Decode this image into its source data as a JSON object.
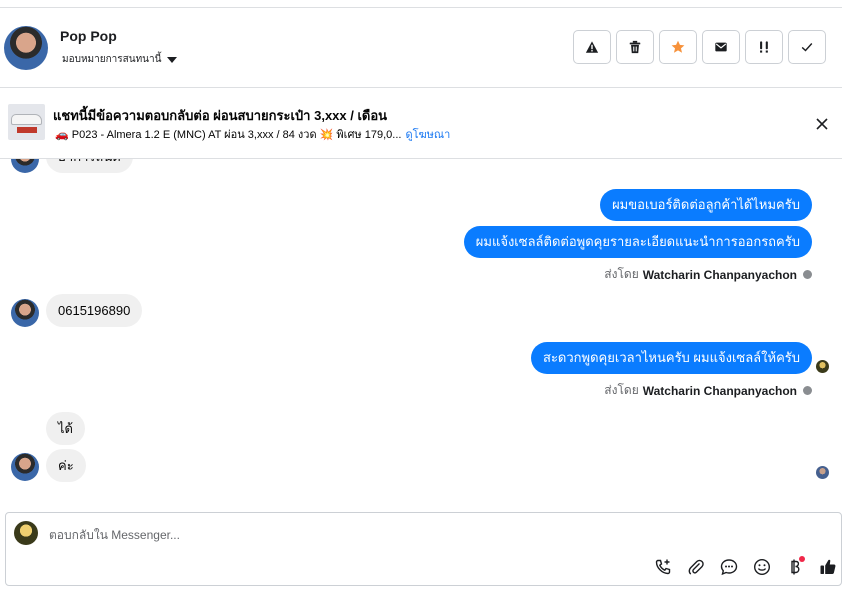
{
  "contact": {
    "name": "Pop Pop",
    "assign_label": "มอบหมายการสนทนานี้"
  },
  "header_actions": [
    {
      "name": "report-spam-icon"
    },
    {
      "name": "trash-icon"
    },
    {
      "name": "star-icon"
    },
    {
      "name": "mark-unread-icon"
    },
    {
      "name": "follow-up-icon"
    },
    {
      "name": "done-check-icon"
    }
  ],
  "ad": {
    "title": "แชทนี้มีข้อความตอบกลับต่อ ผ่อนสบายกระเป๋า 3,xxx / เดือน",
    "subtitle": "🚗 P023 - Almera 1.2 E (MNC) AT ผ่อน 3,xxx / 84 งวด 💥 พิเศษ 179,0...",
    "link": "ดูโฆษณา"
  },
  "messages": {
    "m0": "ฮาการลนด",
    "m1": "ผมขอเบอร์ติดต่อลูกค้าได้ไหมครับ",
    "m2": "ผมแจ้งเซลล์ติดต่อพูดคุยรายละเอียดแนะนำการออกรถครับ",
    "sent_prefix_1": "ส่งโดย",
    "sent_name_1": "Watcharin Chanpanyachon",
    "m3": "0615196890",
    "m4": "สะดวกพูดคุยเวลาไหนครับ ผมแจ้งเซลล์ให้ครับ",
    "sent_prefix_2": "ส่งโดย",
    "sent_name_2": "Watcharin Chanpanyachon",
    "m5": "ได้",
    "m6": "ค่ะ"
  },
  "composer": {
    "placeholder": "ตอบกลับใน Messenger..."
  },
  "colors": {
    "outgoing_bubble": "#0a7cff",
    "incoming_bubble": "#f0f0f0",
    "star": "#f7923b",
    "link": "#1877f2",
    "notification_dot": "#f02849"
  }
}
